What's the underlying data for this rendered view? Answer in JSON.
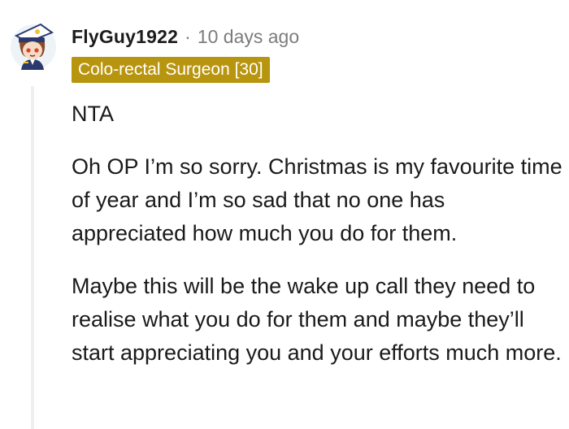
{
  "comment": {
    "author": "FlyGuy1922",
    "separator": "·",
    "time_ago": "10 days ago",
    "flair": "Colo-rectal Surgeon [30]",
    "flair_color": "#b8950f",
    "avatar_icon": "pilot-avatar-icon",
    "paragraphs": [
      "NTA",
      "Oh OP I’m so sorry. Christmas is my favourite time of year and I’m so sad that no one has appreciated how much you do for them.",
      "Maybe this will be the wake up call they need to realise what you do for them and maybe they’ll start appreciating you and your efforts much more."
    ]
  }
}
